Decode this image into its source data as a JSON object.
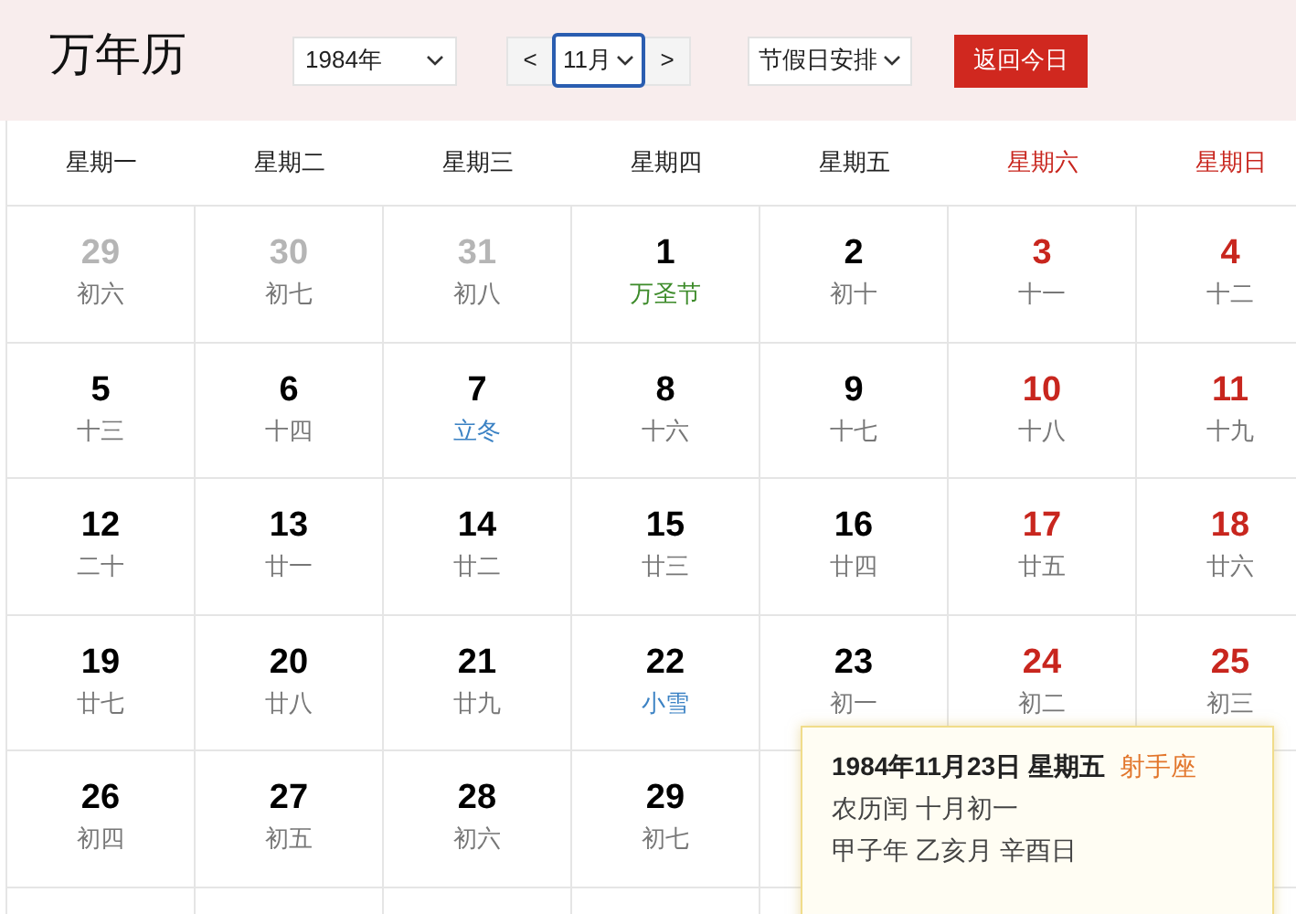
{
  "header": {
    "title": "万年历",
    "year_select": "1984年",
    "prev": "<",
    "month_select": "11月",
    "next": ">",
    "holiday_select": "节假日安排",
    "today_button": "返回今日"
  },
  "weekdays": [
    {
      "label": "星期一",
      "weekend": false
    },
    {
      "label": "星期二",
      "weekend": false
    },
    {
      "label": "星期三",
      "weekend": false
    },
    {
      "label": "星期四",
      "weekend": false
    },
    {
      "label": "星期五",
      "weekend": false
    },
    {
      "label": "星期六",
      "weekend": true
    },
    {
      "label": "星期日",
      "weekend": true
    }
  ],
  "weeks": [
    [
      {
        "day": "29",
        "lunar": "初六",
        "kind": "lunar",
        "other_month": true
      },
      {
        "day": "30",
        "lunar": "初七",
        "kind": "lunar",
        "other_month": true
      },
      {
        "day": "31",
        "lunar": "初八",
        "kind": "lunar",
        "other_month": true
      },
      {
        "day": "1",
        "lunar": "万圣节",
        "kind": "festival",
        "other_month": false
      },
      {
        "day": "2",
        "lunar": "初十",
        "kind": "lunar",
        "other_month": false
      },
      {
        "day": "3",
        "lunar": "十一",
        "kind": "lunar",
        "other_month": false
      },
      {
        "day": "4",
        "lunar": "十二",
        "kind": "lunar",
        "other_month": false
      }
    ],
    [
      {
        "day": "5",
        "lunar": "十三",
        "kind": "lunar",
        "other_month": false
      },
      {
        "day": "6",
        "lunar": "十四",
        "kind": "lunar",
        "other_month": false
      },
      {
        "day": "7",
        "lunar": "立冬",
        "kind": "term",
        "other_month": false
      },
      {
        "day": "8",
        "lunar": "十六",
        "kind": "lunar",
        "other_month": false
      },
      {
        "day": "9",
        "lunar": "十七",
        "kind": "lunar",
        "other_month": false
      },
      {
        "day": "10",
        "lunar": "十八",
        "kind": "lunar",
        "other_month": false
      },
      {
        "day": "11",
        "lunar": "十九",
        "kind": "lunar",
        "other_month": false
      }
    ],
    [
      {
        "day": "12",
        "lunar": "二十",
        "kind": "lunar",
        "other_month": false
      },
      {
        "day": "13",
        "lunar": "廿一",
        "kind": "lunar",
        "other_month": false
      },
      {
        "day": "14",
        "lunar": "廿二",
        "kind": "lunar",
        "other_month": false
      },
      {
        "day": "15",
        "lunar": "廿三",
        "kind": "lunar",
        "other_month": false
      },
      {
        "day": "16",
        "lunar": "廿四",
        "kind": "lunar",
        "other_month": false
      },
      {
        "day": "17",
        "lunar": "廿五",
        "kind": "lunar",
        "other_month": false
      },
      {
        "day": "18",
        "lunar": "廿六",
        "kind": "lunar",
        "other_month": false
      }
    ],
    [
      {
        "day": "19",
        "lunar": "廿七",
        "kind": "lunar",
        "other_month": false
      },
      {
        "day": "20",
        "lunar": "廿八",
        "kind": "lunar",
        "other_month": false
      },
      {
        "day": "21",
        "lunar": "廿九",
        "kind": "lunar",
        "other_month": false
      },
      {
        "day": "22",
        "lunar": "小雪",
        "kind": "term",
        "other_month": false
      },
      {
        "day": "23",
        "lunar": "初一",
        "kind": "lunar",
        "other_month": false
      },
      {
        "day": "24",
        "lunar": "初二",
        "kind": "lunar",
        "other_month": false
      },
      {
        "day": "25",
        "lunar": "初三",
        "kind": "lunar",
        "other_month": false
      }
    ],
    [
      {
        "day": "26",
        "lunar": "初四",
        "kind": "lunar",
        "other_month": false
      },
      {
        "day": "27",
        "lunar": "初五",
        "kind": "lunar",
        "other_month": false
      },
      {
        "day": "28",
        "lunar": "初六",
        "kind": "lunar",
        "other_month": false
      },
      {
        "day": "29",
        "lunar": "初七",
        "kind": "lunar",
        "other_month": false
      }
    ]
  ],
  "popup": {
    "date": "1984年11月23日 星期五",
    "zodiac": "射手座",
    "lunar": "农历闰 十月初一",
    "ganzhi": "甲子年 乙亥月 辛酉日"
  }
}
